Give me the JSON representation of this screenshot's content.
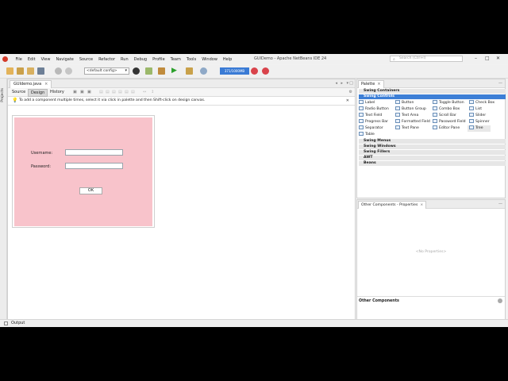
{
  "window": {
    "title": "GUIDemo - Apache NetBeans IDE 24",
    "search_placeholder": "Search (Ctrl+I)",
    "minimize": "–",
    "maximize": "□",
    "close": "✕"
  },
  "menu": [
    "File",
    "Edit",
    "View",
    "Navigate",
    "Source",
    "Refactor",
    "Run",
    "Debug",
    "Profile",
    "Team",
    "Tools",
    "Window",
    "Help"
  ],
  "toolbar": {
    "config_value": "<default config>",
    "memory": "371/1000MB"
  },
  "sidebar": {
    "projects_label": "Projects"
  },
  "editor": {
    "file_tab": "GUIdemo.java",
    "view_tabs": [
      "Source",
      "Design",
      "History"
    ],
    "active_view": "Design",
    "hint": "To add a component multiple times, select it via click in palette and then Shift-click on design canvas."
  },
  "form": {
    "username_label": "Username:",
    "password_label": "Password:",
    "ok_label": "OK",
    "background": "#f8c3cb"
  },
  "palette": {
    "tab": "Palette",
    "categories": {
      "containers": "Swing Containers",
      "controls": "Swing Controls",
      "menus": "Swing Menus",
      "windows": "Swing Windows",
      "fillers": "Swing Fillers",
      "awt": "AWT",
      "beans": "Beans"
    },
    "items": [
      [
        "Label",
        "Button",
        "Toggle Button",
        "Check Box"
      ],
      [
        "Radio Button",
        "Button Group",
        "Combo Box",
        "List"
      ],
      [
        "Text Field",
        "Text Area",
        "Scroll Bar",
        "Slider"
      ],
      [
        "Progress Bar",
        "Formatted Field",
        "Password Field",
        "Spinner"
      ],
      [
        "Separator",
        "Text Pane",
        "Editor Pane",
        "Tree"
      ],
      [
        "Table"
      ]
    ]
  },
  "properties": {
    "tab": "Other Components - Properties",
    "empty": "<No Properties>",
    "other_components": "Other Components"
  },
  "status": {
    "output": "Output"
  },
  "colors": {
    "accent": "#3d7fd6",
    "memory_bar": "#3a7bd5"
  }
}
